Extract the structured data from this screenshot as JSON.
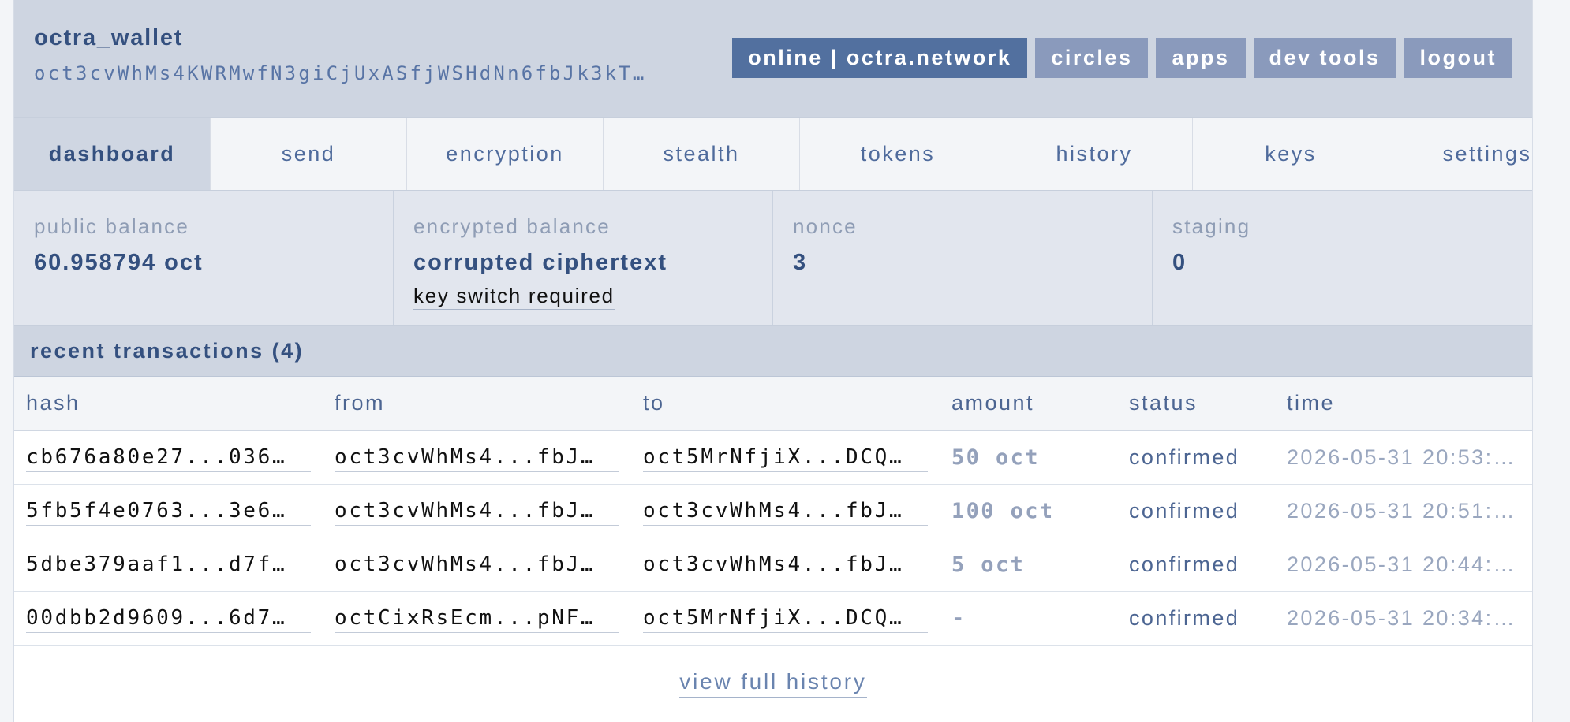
{
  "header": {
    "title": "octra_wallet",
    "address": "oct3cvWhMs4KWRMwfN3giCjUxASfjWSHdNn6fbJk3kT…",
    "buttons": [
      {
        "label": "online | octra.network",
        "active": true
      },
      {
        "label": "circles",
        "active": false
      },
      {
        "label": "apps",
        "active": false
      },
      {
        "label": "dev tools",
        "active": false
      },
      {
        "label": "logout",
        "active": false
      }
    ]
  },
  "tabs": [
    {
      "label": "dashboard",
      "active": true
    },
    {
      "label": "send",
      "active": false
    },
    {
      "label": "encryption",
      "active": false
    },
    {
      "label": "stealth",
      "active": false
    },
    {
      "label": "tokens",
      "active": false
    },
    {
      "label": "history",
      "active": false
    },
    {
      "label": "keys",
      "active": false
    },
    {
      "label": "settings",
      "active": false
    }
  ],
  "stats": {
    "public_balance": {
      "label": "public balance",
      "value": "60.958794 oct"
    },
    "encrypted_balance": {
      "label": "encrypted balance",
      "value": "corrupted ciphertext",
      "note": "key switch required"
    },
    "nonce": {
      "label": "nonce",
      "value": "3"
    },
    "staging": {
      "label": "staging",
      "value": "0"
    }
  },
  "recent": {
    "title": "recent transactions (4)"
  },
  "table": {
    "headers": {
      "hash": "hash",
      "from": "from",
      "to": "to",
      "amount": "amount",
      "status": "status",
      "time": "time"
    },
    "rows": [
      {
        "hash": "cb676a80e27...036…",
        "from": "oct3cvWhMs4...fbJ…",
        "to": "oct5MrNfjiX...DCQ…",
        "amount": "50 oct",
        "status": "confirmed",
        "time": "2026-05-31 20:53:…"
      },
      {
        "hash": "5fb5f4e0763...3e6…",
        "from": "oct3cvWhMs4...fbJ…",
        "to": "oct3cvWhMs4...fbJ…",
        "amount": "100 oct",
        "status": "confirmed",
        "time": "2026-05-31 20:51:…"
      },
      {
        "hash": "5dbe379aaf1...d7f…",
        "from": "oct3cvWhMs4...fbJ…",
        "to": "oct3cvWhMs4...fbJ…",
        "amount": "5 oct",
        "status": "confirmed",
        "time": "2026-05-31 20:44:…"
      },
      {
        "hash": "00dbb2d9609...6d7…",
        "from": "octCixRsEcm...pNF…",
        "to": "oct5MrNfjiX...DCQ…",
        "amount": "-",
        "status": "confirmed",
        "time": "2026-05-31 20:34:…"
      }
    ]
  },
  "footer": {
    "link": "view full history"
  },
  "colors": {
    "header_bg": "#ced5e1",
    "accent": "#52709f",
    "button_muted": "#8a9abc",
    "text_primary": "#34507f"
  }
}
